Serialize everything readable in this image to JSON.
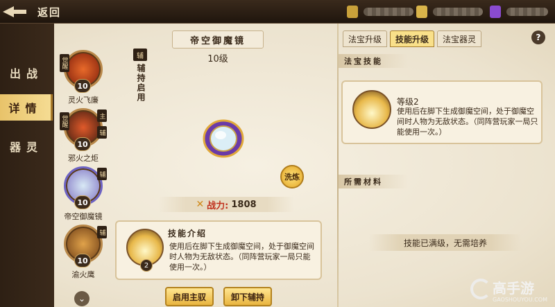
{
  "topbar": {
    "back_label": "返回"
  },
  "left_tabs": [
    {
      "label": "出战"
    },
    {
      "label": "详情"
    },
    {
      "label": "器灵"
    }
  ],
  "weapons": [
    {
      "name": "灵火飞廉",
      "level": "10",
      "tag": "觉醒"
    },
    {
      "name": "邪火之炬",
      "level": "10",
      "tag": "觉醒",
      "role": "主",
      "role2": "辅"
    },
    {
      "name": "帝空御魔镜",
      "level": "10",
      "role": "辅"
    },
    {
      "name": "渝火鹰",
      "level": "10",
      "role": "辅"
    }
  ],
  "detail": {
    "title": "帝空御魔镜",
    "level": "10级",
    "assist_badge": "辅",
    "assist_text": "辅持启用",
    "refine": "洗炼",
    "power_label": "战力:",
    "power_value": "1808",
    "skill_title": "技能介绍",
    "skill_level": "2",
    "skill_desc": "使用后在脚下生成御魔空间，处于御魔空间时人物为无敌状态。（同阵营玩家一局只能使用一次。）",
    "btn_enable_main": "启用主驭",
    "btn_unload_assist": "卸下辅持"
  },
  "right": {
    "tabs": [
      {
        "label": "法宝升级"
      },
      {
        "label": "技能升级"
      },
      {
        "label": "法宝器灵"
      }
    ],
    "help": "?",
    "section_skill": "法宝技能",
    "skill_level": "等级2",
    "skill_desc": "使用后在脚下生成御魔空间，处于御魔空间时人物为无敌状态。（同阵营玩家一局只能使用一次。）",
    "section_materials": "所需材料",
    "max_text": "技能已满级，无需培养"
  },
  "watermark": {
    "text": "高手游",
    "sub": "GAOSHOUYOU.COM"
  }
}
